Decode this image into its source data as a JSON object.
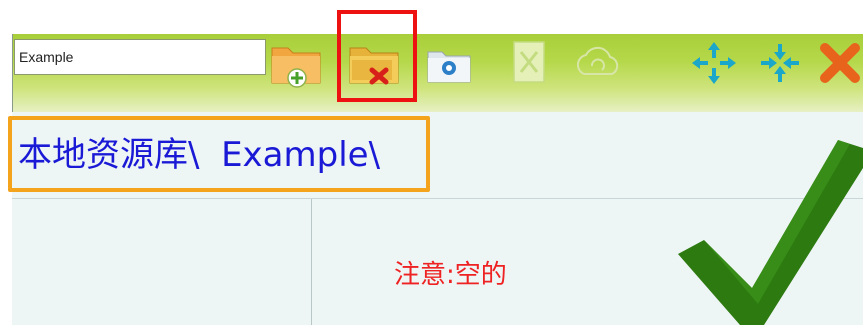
{
  "toolbar": {
    "name_input_value": "Example",
    "icons": [
      "add-folder-icon",
      "delete-folder-icon",
      "folder-settings-icon",
      "excel-export-icon",
      "cloud-sync-icon",
      "expand-arrows-icon",
      "collapse-arrows-icon",
      "close-icon"
    ]
  },
  "breadcrumb": {
    "path": "本地资源库\\  Example\\"
  },
  "main": {
    "notice": "注意:空的"
  },
  "colors": {
    "toolbar_green": "#b5d84a",
    "highlight_red": "#ee1111",
    "breadcrumb_orange": "#f4a31c",
    "breadcrumb_text": "#1a1ad6",
    "notice_red": "#ee2222",
    "checkmark_green": "#2c7a10"
  }
}
